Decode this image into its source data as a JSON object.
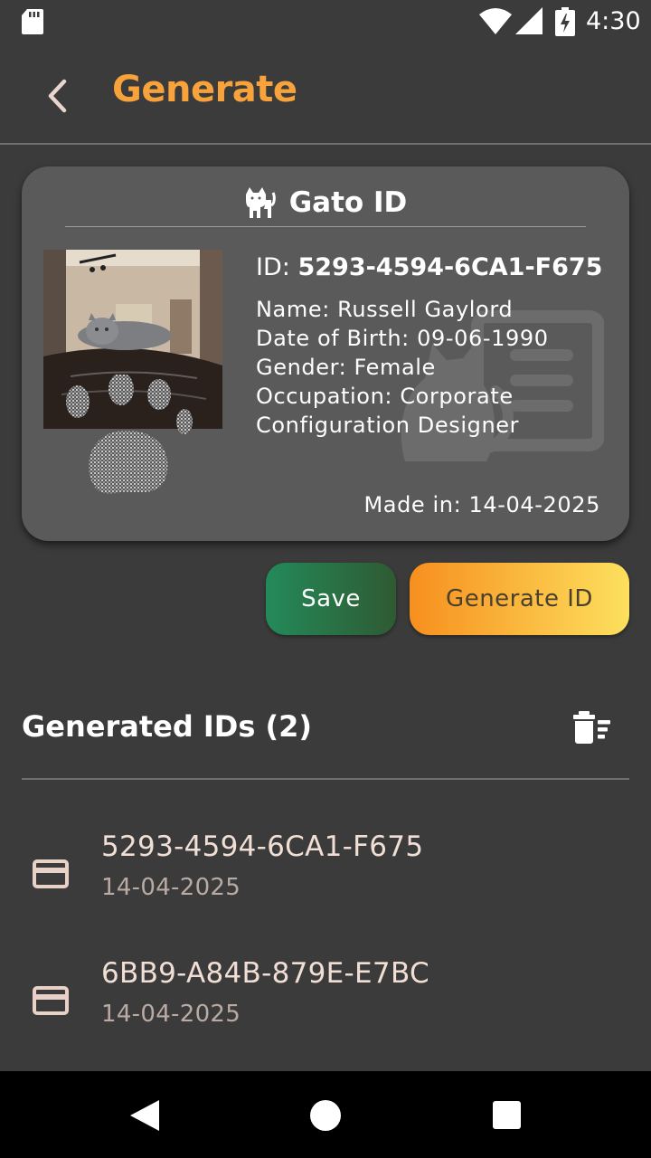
{
  "status_bar": {
    "time": "4:30",
    "icons": [
      "sd-card-icon",
      "wifi-icon",
      "signal-icon",
      "battery-charging-icon"
    ]
  },
  "app_bar": {
    "title": "Generate",
    "back_icon": "chevron-left-icon",
    "title_color": "#f7a23a"
  },
  "card": {
    "icon": "cat-icon",
    "title": "Gato ID",
    "id_label": "ID:",
    "id_value": "5293-4594-6CA1-F675",
    "name_line": "Name: Russell Gaylord",
    "dob_line": "Date of Birth: 09-06-1990",
    "gender_line": "Gender: Female",
    "occupation_line1": "Occupation: Corporate",
    "occupation_line2": "Configuration Designer",
    "made_in": "Made in: 14-04-2025",
    "background_color": "#5a5a5a"
  },
  "actions": {
    "save_label": "Save",
    "generate_label": "Generate ID",
    "save_color": "#238a5a",
    "generate_gradient": [
      "#f78f1e",
      "#fde05e"
    ]
  },
  "history": {
    "title": "Generated IDs (2)",
    "clear_icon": "delete-sweep-icon",
    "items": [
      {
        "id": "5293-4594-6CA1-F675",
        "date": "14-04-2025",
        "icon": "credit-card-icon"
      },
      {
        "id": "6BB9-A84B-879E-E7BC",
        "date": "14-04-2025",
        "icon": "credit-card-icon"
      }
    ]
  },
  "nav_bar": {
    "icons": [
      "nav-back-icon",
      "nav-home-icon",
      "nav-recents-icon"
    ]
  }
}
